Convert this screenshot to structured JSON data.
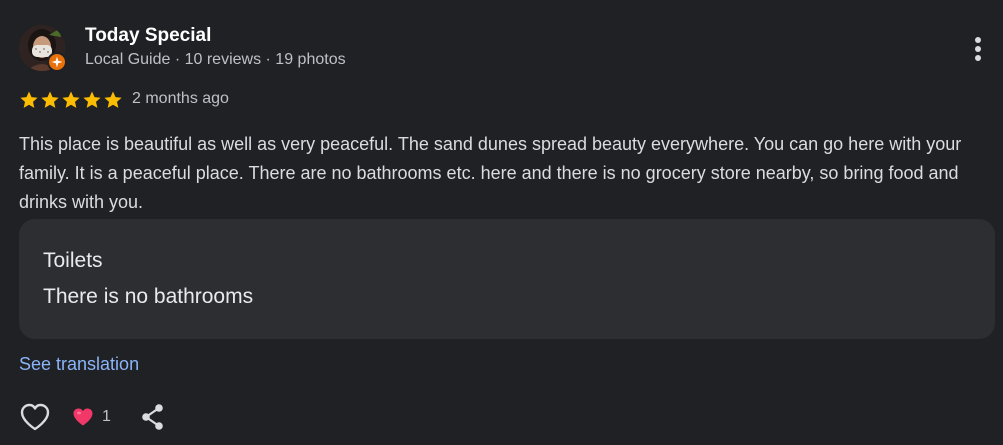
{
  "review": {
    "author_name": "Today Special",
    "author_meta": "Local Guide · 10 reviews · 19 photos",
    "rating": 5,
    "rating_max": 5,
    "date": "2 months ago",
    "text": "This place is beautiful as well as very peaceful. The sand dunes spread beauty everywhere. You can go here with your family. It is a peaceful place. There are no bathrooms etc. here and there is no grocery store nearby, so bring food and drinks with you.",
    "attributes": [
      {
        "title": "Toilets",
        "value": "There is no bathrooms"
      }
    ],
    "see_translation": "See translation",
    "reaction_count": "1"
  },
  "colors": {
    "background": "#202124",
    "card": "#2d2e31",
    "star": "#fbbc04",
    "link": "#8ab4f8",
    "guide_badge": "#e8710a",
    "heart": "#f23868"
  },
  "icons": {
    "more": "more-vert-icon",
    "badge": "local-guide-icon",
    "star": "star-icon",
    "like": "heart-outline-icon",
    "reaction": "heart-filled-icon",
    "share": "share-icon"
  }
}
